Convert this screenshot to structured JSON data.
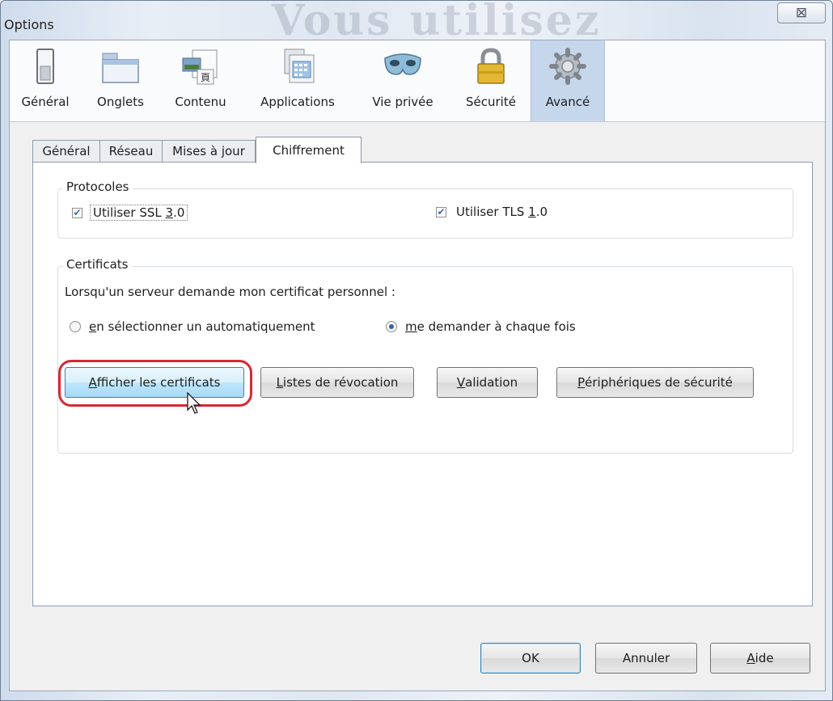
{
  "window": {
    "title": "Options",
    "ghost_text": "Vous utilisez",
    "close_glyph": "⊠"
  },
  "toolbar": {
    "items": [
      {
        "label": "Général",
        "icon": "general-switch-icon"
      },
      {
        "label": "Onglets",
        "icon": "tabs-window-icon"
      },
      {
        "label": "Contenu",
        "icon": "content-page-icon"
      },
      {
        "label": "Applications",
        "icon": "applications-calendar-icon"
      },
      {
        "label": "Vie privée",
        "icon": "privacy-mask-icon"
      },
      {
        "label": "Sécurité",
        "icon": "security-padlock-icon"
      },
      {
        "label": "Avancé",
        "icon": "advanced-gear-icon"
      }
    ],
    "selected": "Avancé"
  },
  "subtabs": [
    {
      "label": "Général"
    },
    {
      "label": "Réseau"
    },
    {
      "label": "Mises à jour"
    },
    {
      "label": "Chiffrement"
    }
  ],
  "subtab_selected": "Chiffrement",
  "protocols": {
    "legend": "Protocoles",
    "ssl": {
      "pre": "Utiliser SSL ",
      "key": "3",
      "post": ".0",
      "checked": true
    },
    "tls": {
      "pre": "Utiliser TLS ",
      "key": "1",
      "post": ".0",
      "checked": true
    }
  },
  "certificates": {
    "legend": "Certificats",
    "prompt": "Lorsqu'un serveur demande mon certificat personnel :",
    "radio_auto": {
      "key": "e",
      "rest": "n sélectionner un automatiquement",
      "selected": false
    },
    "radio_ask": {
      "key": "m",
      "rest": "e demander à chaque fois",
      "selected": true
    },
    "buttons": [
      {
        "key": "A",
        "rest": "fficher les certificats"
      },
      {
        "key": "L",
        "rest": "istes de révocation"
      },
      {
        "key": "V",
        "rest": "alidation"
      },
      {
        "key": "P",
        "rest": "ériphériques de sécurité"
      }
    ]
  },
  "dialog_buttons": {
    "ok": "OK",
    "cancel": "Annuler",
    "help_key": "A",
    "help_rest": "ide"
  },
  "colors": {
    "highlight": "#d42a35",
    "selected_tab": "#c6d7ec",
    "check": "#3b6fb0"
  }
}
